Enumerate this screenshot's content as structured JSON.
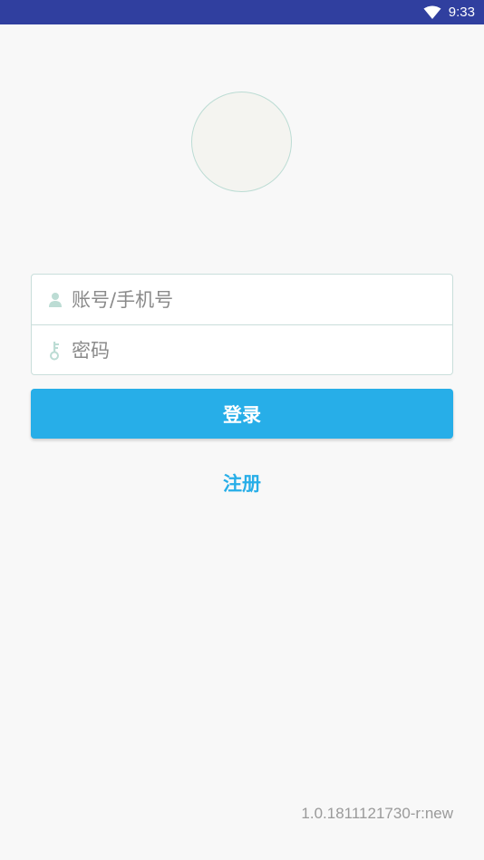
{
  "status_bar": {
    "time": "9:33",
    "icon": "wifi-icon"
  },
  "login": {
    "account_placeholder": "账号/手机号",
    "password_placeholder": "密码",
    "login_label": "登录",
    "register_label": "注册"
  },
  "footer": {
    "version": "1.0.1811121730-r:new"
  },
  "colors": {
    "status_bar": "#303f9f",
    "accent": "#27aee8",
    "background": "#f8f8f8",
    "icon_tint": "#bcdcd4"
  }
}
